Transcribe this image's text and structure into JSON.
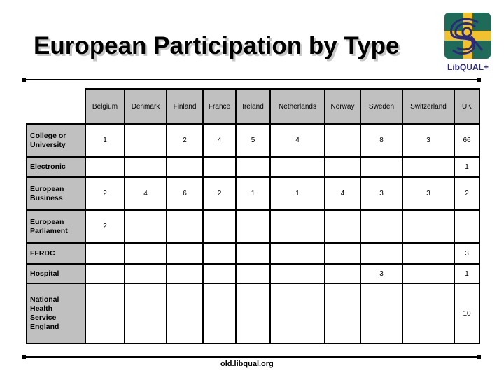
{
  "title": "European Participation by Type",
  "logo": {
    "icon": "libqual-logo-icon",
    "text": "LibQUAL+",
    "colors": {
      "green": "#1f6b5a",
      "yellow": "#f2c12e",
      "navy": "#2b2b7a"
    }
  },
  "table": {
    "columns": [
      "Belgium",
      "Denmark",
      "Finland",
      "France",
      "Ireland",
      "Netherlands",
      "Norway",
      "Sweden",
      "Switzerland",
      "UK"
    ],
    "rows": [
      {
        "label": "College or University",
        "values": [
          "1",
          "",
          "2",
          "4",
          "5",
          "4",
          "",
          "8",
          "3",
          "66"
        ]
      },
      {
        "label": "Electronic",
        "values": [
          "",
          "",
          "",
          "",
          "",
          "",
          "",
          "",
          "",
          "1"
        ]
      },
      {
        "label": "European Business",
        "values": [
          "2",
          "4",
          "6",
          "2",
          "1",
          "1",
          "4",
          "3",
          "3",
          "2"
        ]
      },
      {
        "label": "European Parliament",
        "values": [
          "2",
          "",
          "",
          "",
          "",
          "",
          "",
          "",
          "",
          ""
        ]
      },
      {
        "label": "FFRDC",
        "values": [
          "",
          "",
          "",
          "",
          "",
          "",
          "",
          "",
          "",
          "3"
        ]
      },
      {
        "label": "Hospital",
        "values": [
          "",
          "",
          "",
          "",
          "",
          "",
          "",
          "3",
          "",
          "1"
        ]
      },
      {
        "label": "National Health Service England",
        "values": [
          "",
          "",
          "",
          "",
          "",
          "",
          "",
          "",
          "",
          "10"
        ]
      }
    ],
    "header_bg": "#c0c0c0"
  },
  "footer": "old.libqual.org"
}
